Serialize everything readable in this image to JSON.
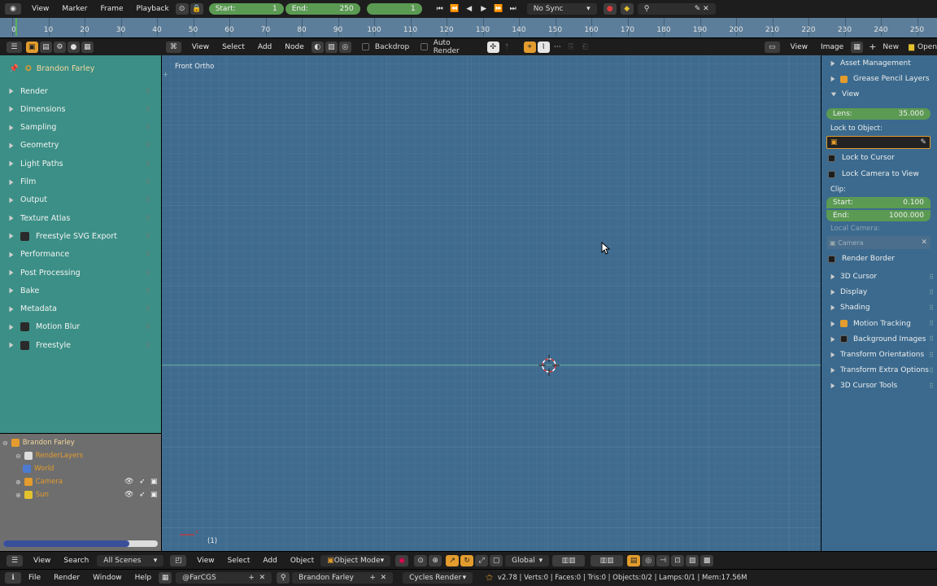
{
  "timeline": {
    "menu": [
      "View",
      "Marker",
      "Frame",
      "Playback"
    ],
    "start_label": "Start:",
    "start_value": "1",
    "end_label": "End:",
    "end_value": "250",
    "current_frame": "1",
    "sync": "No Sync",
    "ruler_ticks": [
      "0",
      "10",
      "20",
      "30",
      "40",
      "50",
      "60",
      "70",
      "80",
      "90",
      "100",
      "110",
      "120",
      "130",
      "140",
      "150",
      "160",
      "170",
      "180",
      "190",
      "200",
      "210",
      "220",
      "230",
      "240",
      "250"
    ]
  },
  "node_header": {
    "menu": [
      "View",
      "Select",
      "Add",
      "Node"
    ],
    "backdrop": "Backdrop",
    "auto_render": "Auto Render"
  },
  "image_header": {
    "menu": [
      "View",
      "Image"
    ],
    "new": "New",
    "open": "Open"
  },
  "properties": {
    "scene_name": "Brandon Farley",
    "panels": [
      {
        "label": "Render",
        "has_checkbox": false
      },
      {
        "label": "Dimensions",
        "has_checkbox": false
      },
      {
        "label": "Sampling",
        "has_checkbox": false
      },
      {
        "label": "Geometry",
        "has_checkbox": false
      },
      {
        "label": "Light Paths",
        "has_checkbox": false
      },
      {
        "label": "Film",
        "has_checkbox": false
      },
      {
        "label": "Output",
        "has_checkbox": false
      },
      {
        "label": "Texture Atlas",
        "has_checkbox": false
      },
      {
        "label": "Freestyle SVG Export",
        "has_checkbox": true
      },
      {
        "label": "Performance",
        "has_checkbox": false
      },
      {
        "label": "Post Processing",
        "has_checkbox": false
      },
      {
        "label": "Bake",
        "has_checkbox": false
      },
      {
        "label": "Metadata",
        "has_checkbox": false
      },
      {
        "label": "Motion Blur",
        "has_checkbox": true
      },
      {
        "label": "Freestyle",
        "has_checkbox": true
      }
    ]
  },
  "viewport": {
    "view_name": "Front Ortho",
    "frame_indicator": "(1)"
  },
  "npanel": {
    "asset_management": "Asset Management",
    "grease_pencil": "Grease Pencil Layers",
    "view": "View",
    "lens_label": "Lens:",
    "lens_value": "35.000",
    "lock_to_object": "Lock to Object:",
    "lock_to_cursor": "Lock to Cursor",
    "lock_camera": "Lock Camera to View",
    "clip": "Clip:",
    "clip_start_label": "Start:",
    "clip_start_value": "0.100",
    "clip_end_label": "End:",
    "clip_end_value": "1000.000",
    "local_camera": "Local Camera:",
    "camera_placeholder": "Camera",
    "render_border": "Render Border",
    "sections": [
      {
        "label": "3D Cursor",
        "check": "none"
      },
      {
        "label": "Display",
        "check": "none"
      },
      {
        "label": "Shading",
        "check": "none"
      },
      {
        "label": "Motion Tracking",
        "check": "on"
      },
      {
        "label": "Background Images",
        "check": "off"
      },
      {
        "label": "Transform Orientations",
        "check": "none"
      },
      {
        "label": "Transform Extra Options",
        "check": "none"
      },
      {
        "label": "3D Cursor Tools",
        "check": "none"
      }
    ]
  },
  "outliner": {
    "menu": [
      "View",
      "Search"
    ],
    "scenes": "All Scenes",
    "items": [
      {
        "label": "Brandon Farley",
        "depth": 0
      },
      {
        "label": "RenderLayers",
        "depth": 1
      },
      {
        "label": "World",
        "depth": 1
      },
      {
        "label": "Camera",
        "depth": 1
      },
      {
        "label": "Sun",
        "depth": 1
      }
    ]
  },
  "view3d_header": {
    "menu": [
      "View",
      "Select",
      "Add",
      "Object"
    ],
    "mode": "Object Mode",
    "orientation": "Global"
  },
  "info": {
    "menu": [
      "File",
      "Render",
      "Window",
      "Help"
    ],
    "screen": "@FarCGS",
    "scene": "Brandon Farley",
    "engine": "Cycles Render",
    "stats": "v2.78 | Verts:0 | Faces:0 | Tris:0 | Objects:0/2 | Lamps:0/1 | Mem:17.56M"
  },
  "colors": {
    "accent_green": "#5b9a53",
    "panel_teal": "#3b8f86",
    "viewport_blue": "#3f6b8f",
    "orange_active": "#e39c2d"
  }
}
